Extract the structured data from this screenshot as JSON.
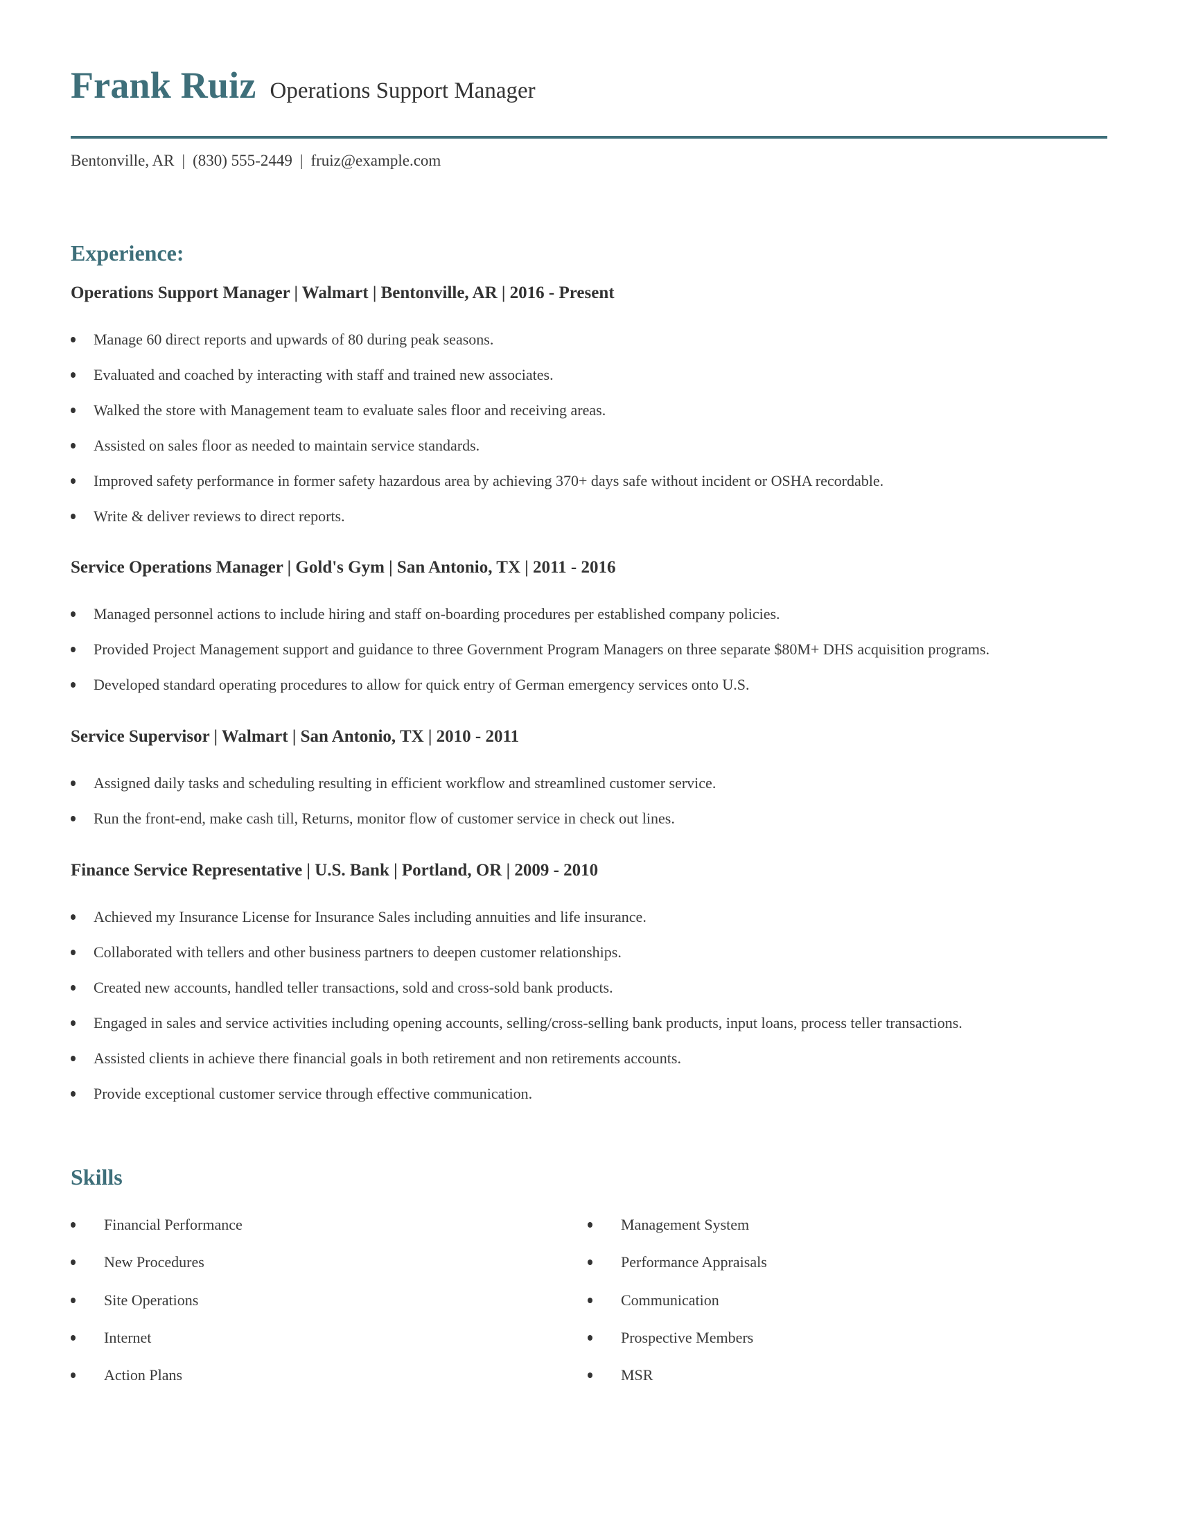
{
  "header": {
    "name": "Frank Ruiz",
    "title": "Operations Support Manager",
    "contact": {
      "location": "Bentonville, AR",
      "phone": "(830) 555-2449",
      "email": "fruiz@example.com",
      "separator": "|"
    }
  },
  "colors": {
    "accent": "#3e6f7a",
    "text": "#333333"
  },
  "experience": {
    "heading": "Experience:",
    "jobs": [
      {
        "heading": "Operations Support Manager | Walmart | Bentonville, AR |  2016 - Present",
        "bullets": [
          "Manage 60 direct reports and upwards of 80 during peak seasons.",
          "Evaluated and coached by interacting with staff and trained new associates.",
          "Walked the store with Management team to evaluate sales floor and receiving areas.",
          "Assisted on sales floor as needed to maintain service standards.",
          "Improved safety performance in former safety hazardous area by achieving 370+ days safe without incident or OSHA recordable.",
          "Write & deliver reviews to direct reports."
        ]
      },
      {
        "heading": "Service Operations Manager | Gold's Gym | San Antonio, TX |  2011 - 2016",
        "bullets": [
          "Managed personnel actions to include hiring and staff on-boarding procedures per established company policies.",
          "Provided Project Management support and guidance to three Government Program Managers on three separate $80M+ DHS acquisition programs.",
          "Developed standard operating procedures to allow for quick entry of German emergency services onto U.S."
        ]
      },
      {
        "heading": "Service Supervisor | Walmart | San Antonio, TX |  2010 - 2011",
        "bullets": [
          "Assigned daily tasks and scheduling resulting in efficient workflow and streamlined customer service.",
          "Run the front-end, make cash till, Returns, monitor flow of customer service in check out lines."
        ]
      },
      {
        "heading": "Finance Service Representative | U.S. Bank | Portland, OR |  2009 - 2010",
        "bullets": [
          "Achieved my Insurance License for Insurance Sales including annuities and life insurance.",
          "Collaborated with tellers and other business partners to deepen customer relationships.",
          "Created new accounts, handled teller transactions, sold and cross-sold bank products.",
          "Engaged in sales and service activities including opening accounts, selling/cross-selling bank products, input loans, process teller transactions.",
          "Assisted clients in achieve there financial goals in both retirement and non retirements accounts.",
          "Provide exceptional customer service through effective communication."
        ]
      }
    ]
  },
  "skills": {
    "heading": "Skills",
    "left": [
      "Financial Performance",
      "New Procedures",
      "Site Operations",
      "Internet",
      "Action Plans"
    ],
    "right": [
      "Management System",
      "Performance Appraisals",
      "Communication",
      "Prospective Members",
      "MSR"
    ]
  }
}
